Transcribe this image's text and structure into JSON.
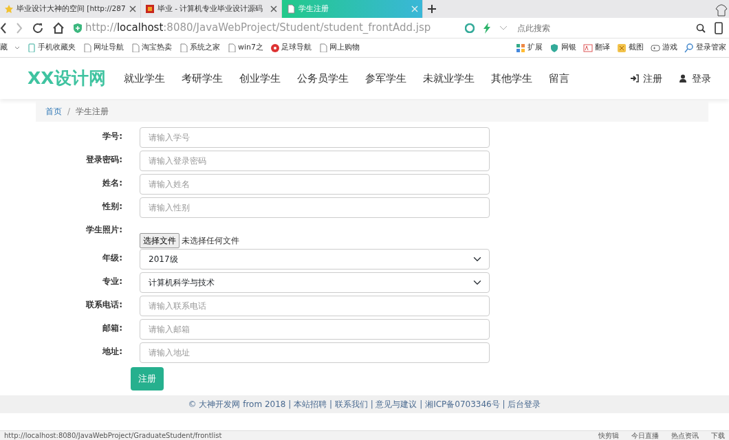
{
  "browser": {
    "tabs": [
      {
        "title": "毕业设计大神的空间 [http://287",
        "selected": false
      },
      {
        "title": "毕业 - 计算机专业毕业设计源码",
        "selected": false
      },
      {
        "title": "学生注册",
        "selected": true
      }
    ],
    "address": {
      "url": "http://**localhost**:8080/JavaWebProject/Student/student_frontAdd.jsp",
      "search_placeholder": "点此搜索"
    },
    "bookmarks": [
      {
        "label": "藏"
      },
      {
        "label": "手机收藏夹"
      },
      {
        "label": "网址导航"
      },
      {
        "label": "淘宝热卖"
      },
      {
        "label": "系统之家"
      },
      {
        "label": "win7之"
      },
      {
        "label": "足球导航"
      },
      {
        "label": "网上购物"
      }
    ],
    "tools": [
      {
        "label": "扩展"
      },
      {
        "label": "网银"
      },
      {
        "label": "翻译"
      },
      {
        "label": "截图"
      },
      {
        "label": "游戏"
      },
      {
        "label": "登录管家"
      }
    ]
  },
  "site": {
    "logo": "XX设计网",
    "nav": [
      "就业学生",
      "考研学生",
      "创业学生",
      "公务员学生",
      "参军学生",
      "未就业学生",
      "其他学生",
      "留言"
    ],
    "account": [
      {
        "label": "注册"
      },
      {
        "label": "登录"
      }
    ],
    "breadcrumb_separator": "/",
    "breadcrumb": [
      {
        "label": "首页",
        "link": true
      },
      {
        "label": "学生注册",
        "link": false
      }
    ],
    "form": [
      {
        "kind": "text",
        "label": "学号:",
        "placeholder": "请输入学号"
      },
      {
        "kind": "text",
        "label": "登录密码:",
        "placeholder": "请输入登录密码"
      },
      {
        "kind": "text",
        "label": "姓名:",
        "placeholder": "请输入姓名"
      },
      {
        "kind": "text",
        "label": "性别:",
        "placeholder": "请输入性别"
      },
      {
        "kind": "file",
        "label": "学生照片:",
        "button": "选择文件",
        "note": "未选择任何文件"
      },
      {
        "kind": "select",
        "label": "年级:",
        "value": "2017级"
      },
      {
        "kind": "select",
        "label": "专业:",
        "value": "计算机科学与技术"
      },
      {
        "kind": "text",
        "label": "联系电话:",
        "placeholder": "请输入联系电话"
      },
      {
        "kind": "text",
        "label": "邮箱:",
        "placeholder": "请输入邮箱"
      },
      {
        "kind": "text",
        "label": "地址:",
        "placeholder": "请输入地址"
      }
    ],
    "submit": "注册",
    "footer": "© 大神开发网 from 2018 | 本站招聘 | 联系我们 | 意见与建议 | 湘ICP备0703346号 | 后台登录"
  },
  "status_bar": {
    "url": "http://localhost:8080/JavaWebProject/GraduateStudent/frontlist",
    "items": [
      "快剪辑",
      "今日直播",
      "热点资讯",
      "下载"
    ]
  }
}
